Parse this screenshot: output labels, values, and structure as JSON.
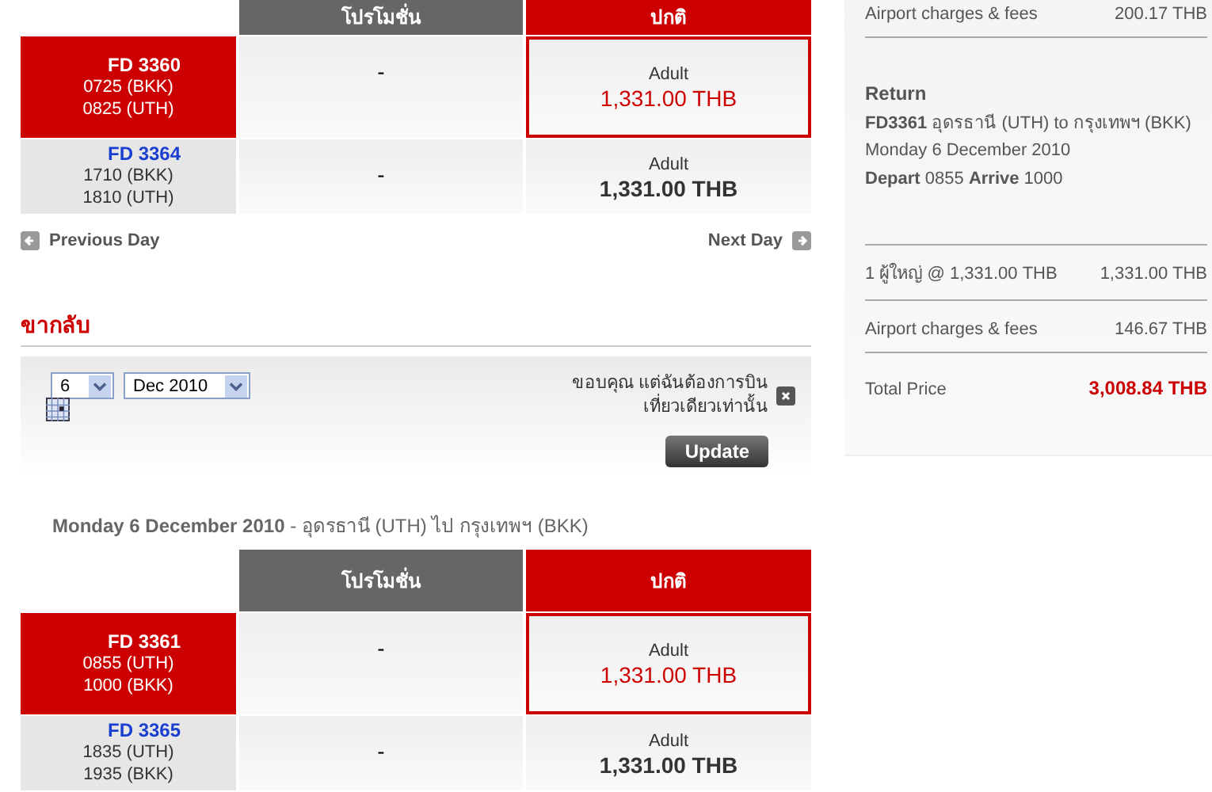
{
  "outbound": {
    "columns": [
      "โปรโมชั่น",
      "ปกติ"
    ],
    "rows": [
      {
        "flight": "FD 3360",
        "depart": "0725 (BKK)",
        "arrive": "0825 (UTH)",
        "promo": "-",
        "fare_label": "Adult",
        "fare_price": "1,331.00 THB",
        "selected": true
      },
      {
        "flight": "FD 3364",
        "depart": "1710 (BKK)",
        "arrive": "1810 (UTH)",
        "promo": "-",
        "fare_label": "Adult",
        "fare_price": "1,331.00 THB",
        "selected": false
      }
    ],
    "prev_day": "Previous Day",
    "next_day": "Next Day"
  },
  "return_section": {
    "heading": "ขากลับ",
    "day_value": "6",
    "month_value": "Dec 2010",
    "one_way_text": "ขอบคุณ แต่ฉันต้องการบิน เที่ยวเดียวเท่านั้น",
    "update_button": "Update",
    "date_heading": "Monday 6 December 2010",
    "route": " - อุดรธานี (UTH)  ไป  กรุงเทพฯ (BKK)",
    "columns": [
      "โปรโมชั่น",
      "ปกติ"
    ],
    "rows": [
      {
        "flight": "FD 3361",
        "depart": "0855 (UTH)",
        "arrive": "1000 (BKK)",
        "promo": "-",
        "fare_label": "Adult",
        "fare_price": "1,331.00 THB",
        "selected": true
      },
      {
        "flight": "FD 3365",
        "depart": "1835 (UTH)",
        "arrive": "1935 (BKK)",
        "promo": "-",
        "fare_label": "Adult",
        "fare_price": "1,331.00 THB",
        "selected": false
      }
    ]
  },
  "summary": {
    "outbound_fees": {
      "label": "Airport charges & fees",
      "amount": "200.17 THB"
    },
    "return_title": "Return",
    "return_flight": "**FD3361** อุดรธานี (UTH) to กรุงเทพฯ (BKK)",
    "return_date": "Monday 6 December 2010",
    "return_times": "**Depart** 0855 **Arrive** 1000",
    "lines": [
      {
        "label": "1 ผู้ใหญ่ @ 1,331.00 THB",
        "amount": "1,331.00 THB"
      },
      {
        "label": "Airport charges & fees",
        "amount": "146.67 THB"
      }
    ],
    "total": {
      "label": "Total Price",
      "amount": "3,008.84 THB"
    }
  }
}
